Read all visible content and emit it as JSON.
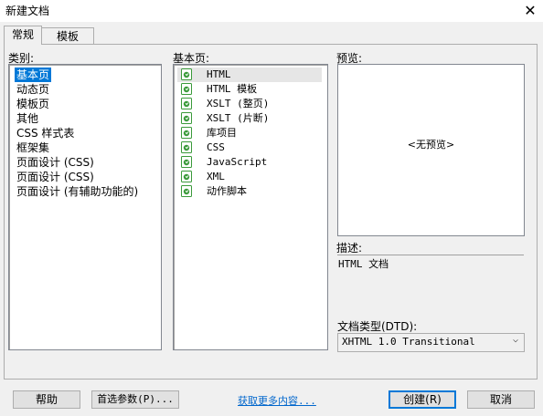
{
  "window": {
    "title": "新建文档",
    "close_glyph": "✕"
  },
  "tabs": [
    {
      "label": "常规",
      "active": true
    },
    {
      "label": "模板",
      "active": false
    }
  ],
  "category": {
    "label": "类别:",
    "items": [
      "基本页",
      "动态页",
      "模板页",
      "其他",
      "CSS 样式表",
      "框架集",
      "页面设计 (CSS)",
      "页面设计 (CSS)",
      "页面设计 (有辅助功能的)"
    ],
    "selected_index": 0
  },
  "basic_page": {
    "label": "基本页:",
    "items": [
      "HTML",
      "HTML 模板",
      "XSLT (整页)",
      "XSLT (片断)",
      "库项目",
      "CSS",
      "JavaScript",
      "XML",
      "动作脚本"
    ],
    "selected_index": 0
  },
  "preview": {
    "label": "预览:",
    "placeholder": "<无预览>"
  },
  "description": {
    "label": "描述:",
    "text": "HTML 文档"
  },
  "doctype": {
    "label": "文档类型(DTD):",
    "value": "XHTML 1.0 Transitional"
  },
  "buttons": {
    "help": "帮助",
    "preferences": "首选参数(P)...",
    "get_more": "获取更多内容...",
    "create": "创建(R)",
    "cancel": "取消"
  },
  "colors": {
    "selection": "#0078d7",
    "link": "#0066cc",
    "icon_green": "#3a9a3a"
  }
}
